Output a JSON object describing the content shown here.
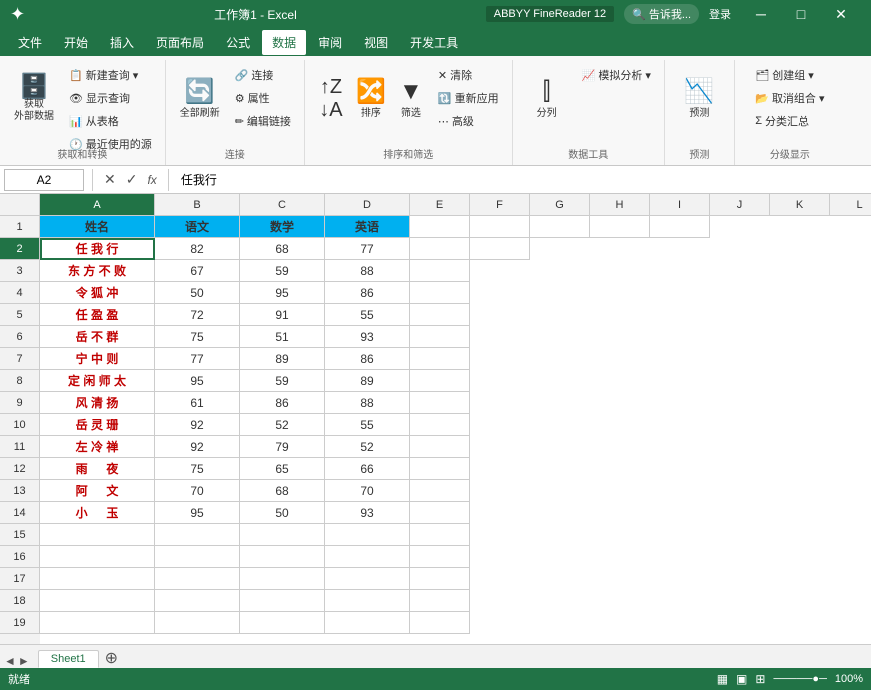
{
  "app": {
    "title": "Microsoft Excel",
    "file": "工作簿1 - Excel"
  },
  "titlebar": {
    "abbyy": "ABBYY FineReader 12",
    "login": "登录",
    "tell": "告诉我..."
  },
  "menu": {
    "items": [
      "文件",
      "开始",
      "插入",
      "页面布局",
      "公式",
      "数据",
      "审阅",
      "视图",
      "开发工具"
    ]
  },
  "ribbon": {
    "active_tab": "数据",
    "groups": [
      {
        "label": "获取和转换",
        "buttons": [
          "获取外部数据",
          "新建查询",
          "显示查询",
          "从表格",
          "最近使用的源"
        ]
      },
      {
        "label": "连接",
        "buttons": [
          "全部刷新",
          "连接",
          "属性",
          "编辑链接"
        ]
      },
      {
        "label": "排序和筛选",
        "buttons": [
          "排序",
          "筛选",
          "清除",
          "重新应用",
          "高级"
        ]
      },
      {
        "label": "数据工具",
        "buttons": [
          "分列",
          "模拟分析"
        ]
      },
      {
        "label": "预测",
        "buttons": [
          "预测"
        ]
      },
      {
        "label": "分级显示",
        "buttons": [
          "创建组",
          "取消组合",
          "分类汇总"
        ]
      }
    ]
  },
  "formula_bar": {
    "cell_ref": "A2",
    "formula": "任我行"
  },
  "columns": {
    "headers": [
      "A",
      "B",
      "C",
      "D",
      "E",
      "F",
      "G",
      "H",
      "I",
      "J",
      "K",
      "L"
    ],
    "widths": [
      115,
      85,
      85,
      85,
      60,
      60,
      60,
      60,
      60,
      60,
      60,
      60
    ]
  },
  "rows": {
    "count": 19,
    "data_rows": [
      1,
      2,
      3,
      4,
      5,
      6,
      7,
      8,
      9,
      10,
      11,
      12,
      13,
      14,
      15,
      16,
      17,
      18,
      19
    ]
  },
  "table": {
    "headers": [
      "姓名",
      "语文",
      "数学",
      "英语"
    ],
    "rows": [
      [
        "任 我 行",
        "82",
        "68",
        "77"
      ],
      [
        "东 方 不 败",
        "67",
        "59",
        "88"
      ],
      [
        "令 狐 冲",
        "50",
        "95",
        "86"
      ],
      [
        "任 盈 盈",
        "72",
        "91",
        "55"
      ],
      [
        "岳 不 群",
        "75",
        "51",
        "93"
      ],
      [
        "宁 中 则",
        "77",
        "89",
        "86"
      ],
      [
        "定 闲 师 太",
        "95",
        "59",
        "89"
      ],
      [
        "风 清 扬",
        "61",
        "86",
        "88"
      ],
      [
        "岳 灵 珊",
        "92",
        "52",
        "55"
      ],
      [
        "左 冷 禅",
        "92",
        "79",
        "52"
      ],
      [
        "雨 　 夜",
        "75",
        "65",
        "66"
      ],
      [
        "阿 　 文",
        "70",
        "68",
        "70"
      ],
      [
        "小 　 玉",
        "95",
        "50",
        "93"
      ]
    ]
  },
  "sheet_tabs": [
    "Sheet1"
  ],
  "status": {
    "text": "就绪",
    "zoom": "100%"
  }
}
